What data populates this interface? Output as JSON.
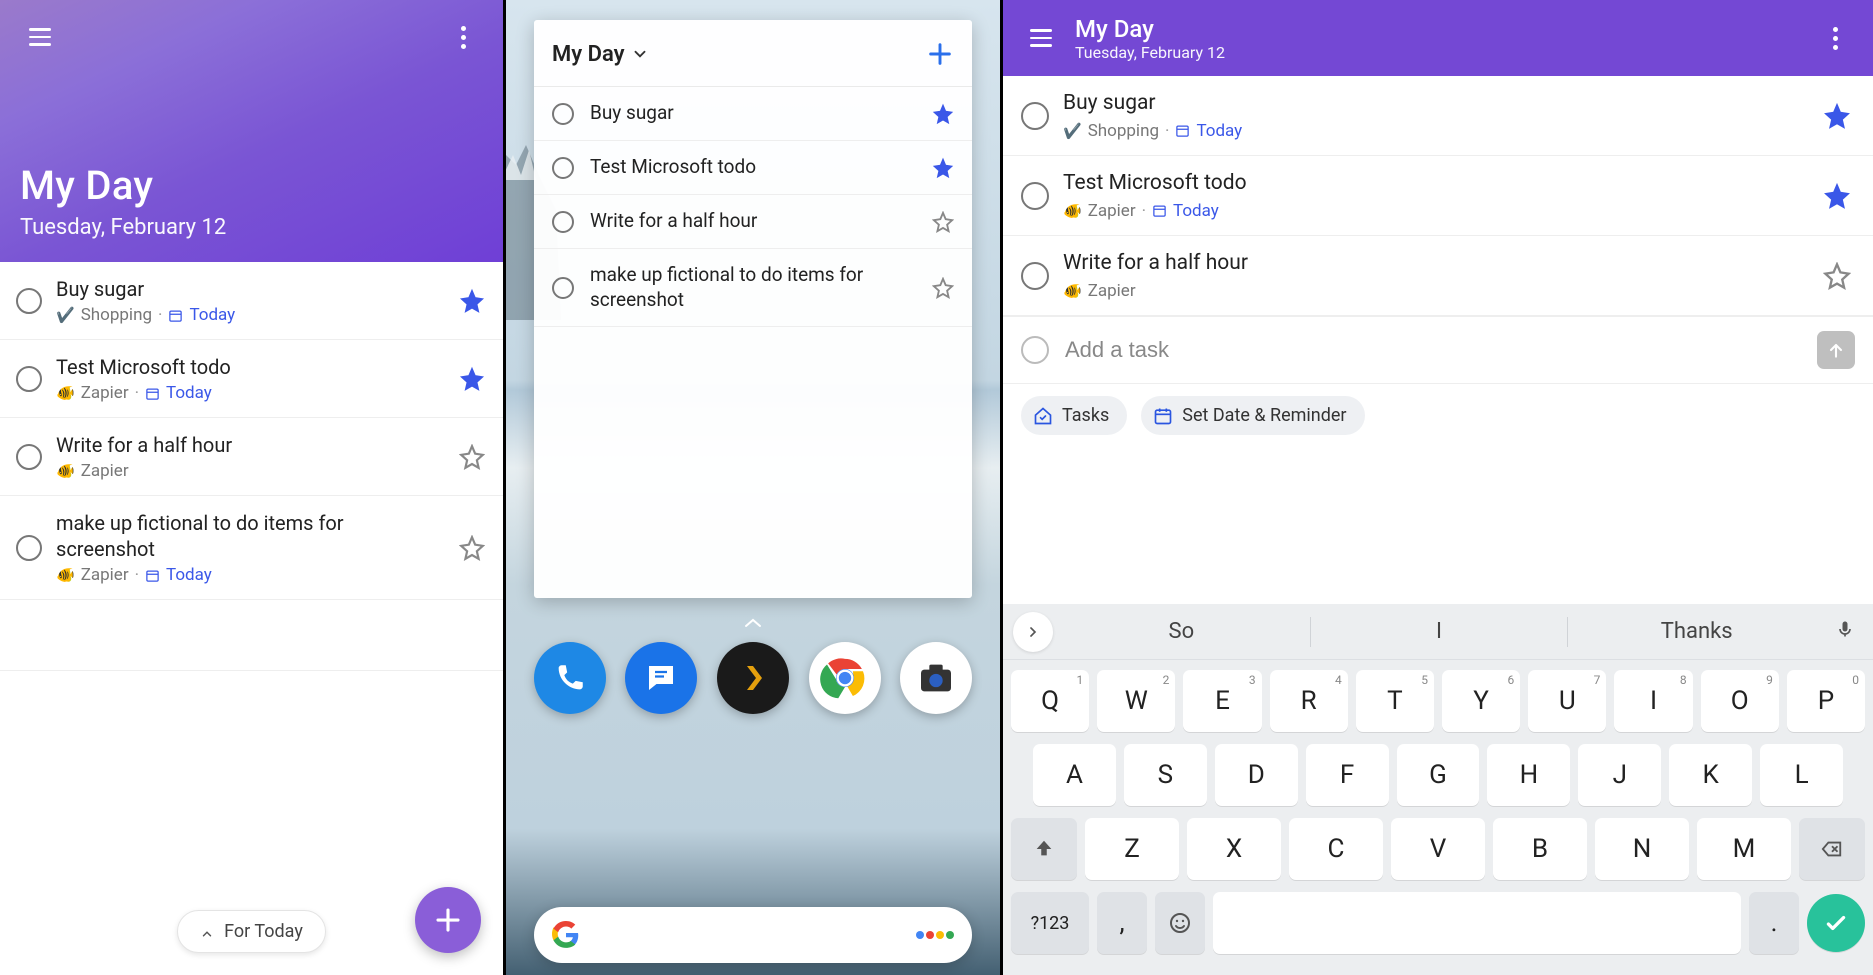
{
  "panel1": {
    "title": "My Day",
    "date": "Tuesday, February 12",
    "for_today_label": "For Today",
    "tasks": {
      "0": {
        "title": "Buy sugar",
        "list_emoji": "✔️",
        "list": "Shopping",
        "has_today": true,
        "today_label": "Today",
        "starred": true
      },
      "1": {
        "title": "Test Microsoft todo",
        "list_emoji": "🐠",
        "list": "Zapier",
        "has_today": true,
        "today_label": "Today",
        "starred": true
      },
      "2": {
        "title": "Write for a half hour",
        "list_emoji": "🐠",
        "list": "Zapier",
        "has_today": false,
        "starred": false
      },
      "3": {
        "title": "make up fictional to do items for screenshot",
        "list_emoji": "🐠",
        "list": "Zapier",
        "has_today": true,
        "today_label": "Today",
        "starred": false
      }
    }
  },
  "panel2": {
    "widget_title": "My Day",
    "tasks": {
      "0": {
        "title": "Buy sugar",
        "starred": true
      },
      "1": {
        "title": "Test Microsoft todo",
        "starred": true
      },
      "2": {
        "title": "Write for a half hour",
        "starred": false
      },
      "3": {
        "title": "make up fictional to do items for screenshot",
        "starred": false
      }
    },
    "dock": {
      "phone": "phone",
      "messages": "messages",
      "plex": "plex",
      "chrome": "chrome",
      "camera": "camera"
    }
  },
  "panel3": {
    "title": "My Day",
    "date": "Tuesday, February 12",
    "tasks": {
      "0": {
        "title": "Buy sugar",
        "list_emoji": "✔️",
        "list": "Shopping",
        "has_today": true,
        "today_label": "Today",
        "starred": true
      },
      "1": {
        "title": "Test Microsoft todo",
        "list_emoji": "🐠",
        "list": "Zapier",
        "has_today": true,
        "today_label": "Today",
        "starred": true
      },
      "2": {
        "title": "Write for a half hour",
        "list_emoji": "🐠",
        "list": "Zapier",
        "has_today": false,
        "starred": false
      }
    },
    "add_placeholder": "Add a task",
    "chips": {
      "tasks": "Tasks",
      "date": "Set Date & Reminder"
    },
    "keyboard": {
      "suggestions": {
        "0": "So",
        "1": "I",
        "2": "Thanks"
      },
      "row1": {
        "0": "Q",
        "1": "W",
        "2": "E",
        "3": "R",
        "4": "T",
        "5": "Y",
        "6": "U",
        "7": "I",
        "8": "O",
        "9": "P"
      },
      "row1_hints": {
        "0": "1",
        "1": "2",
        "2": "3",
        "3": "4",
        "4": "5",
        "5": "6",
        "6": "7",
        "7": "8",
        "8": "9",
        "9": "0"
      },
      "row2": {
        "0": "A",
        "1": "S",
        "2": "D",
        "3": "F",
        "4": "G",
        "5": "H",
        "6": "J",
        "7": "K",
        "8": "L"
      },
      "row3": {
        "0": "Z",
        "1": "X",
        "2": "C",
        "3": "V",
        "4": "B",
        "5": "N",
        "6": "M"
      },
      "sym": "?123",
      "comma": ",",
      "period": "."
    }
  }
}
